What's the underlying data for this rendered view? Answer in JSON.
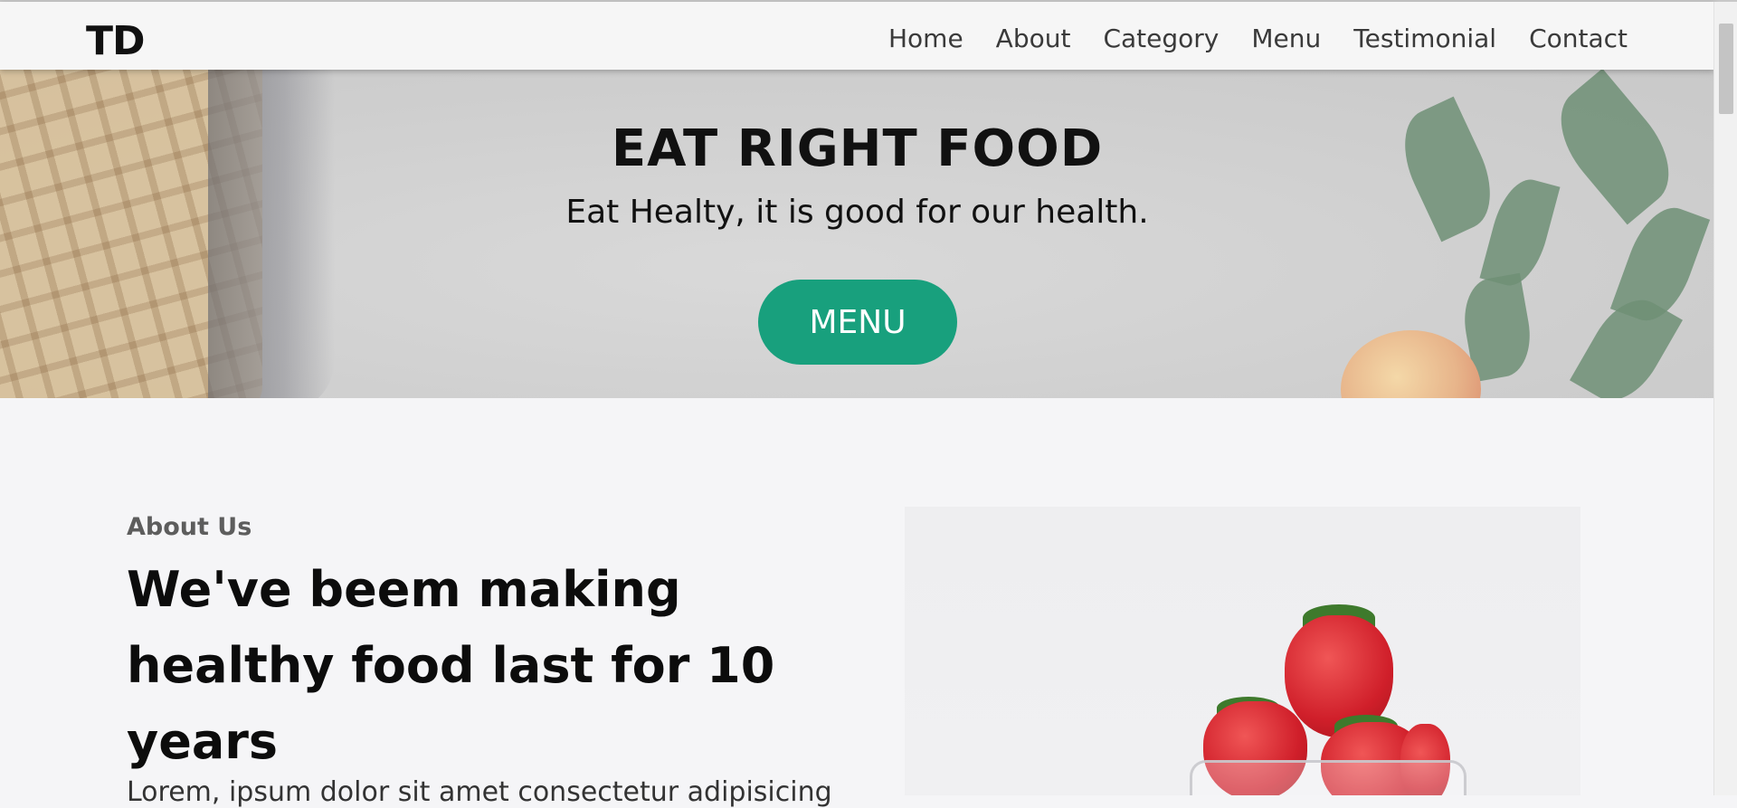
{
  "header": {
    "logo": "TD",
    "nav": [
      {
        "label": "Home"
      },
      {
        "label": "About"
      },
      {
        "label": "Category"
      },
      {
        "label": "Menu"
      },
      {
        "label": "Testimonial"
      },
      {
        "label": "Contact"
      }
    ]
  },
  "hero": {
    "title": "EAT RIGHT FOOD",
    "subtitle": "Eat Healty, it is good for our health.",
    "button_label": "MENU"
  },
  "about": {
    "kicker": "About Us",
    "heading": "We've beem making healthy food last for 10 years",
    "text": "Lorem, ipsum dolor sit amet consectetur adipisicing"
  },
  "colors": {
    "accent": "#18a07d",
    "background": "#f5f5f7"
  }
}
